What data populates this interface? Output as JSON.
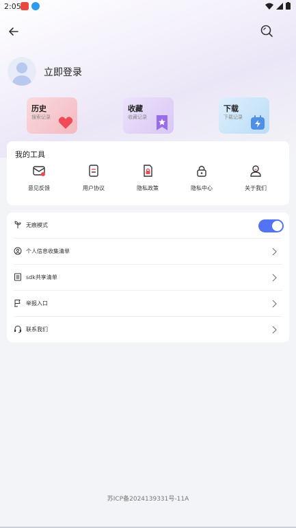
{
  "status_bar": {
    "time": "2:05"
  },
  "header": {
    "back_icon": "back-arrow-icon",
    "search_icon": "search-icon"
  },
  "profile": {
    "login_label": "立即登录"
  },
  "quick_cards": [
    {
      "title": "历史",
      "subtitle": "搜索记录",
      "icon": "heart-icon",
      "color": "#f4b9c0"
    },
    {
      "title": "收藏",
      "subtitle": "收藏记录",
      "icon": "bookmark-star-icon",
      "color": "#d8c7f4"
    },
    {
      "title": "下载",
      "subtitle": "下载记录",
      "icon": "download-calendar-icon",
      "color": "#bcdcf6"
    }
  ],
  "tools": {
    "title": "我的工具",
    "items": [
      {
        "label": "意见反馈",
        "icon": "feedback-mail-icon"
      },
      {
        "label": "用户协议",
        "icon": "document-icon"
      },
      {
        "label": "隐私政策",
        "icon": "privacy-doc-lock-icon"
      },
      {
        "label": "隐私中心",
        "icon": "lock-icon"
      },
      {
        "label": "关于我们",
        "icon": "user-icon"
      }
    ]
  },
  "settings": [
    {
      "label": "无痕模式",
      "icon": "sprout-icon",
      "toggle_on": true
    },
    {
      "label": "个人信息收集清单",
      "icon": "user-circle-icon"
    },
    {
      "label": "sdk共享清单",
      "icon": "list-icon"
    },
    {
      "label": "举报入口",
      "icon": "report-icon"
    },
    {
      "label": "联系我们",
      "icon": "headset-icon"
    }
  ],
  "footer": {
    "icp": "苏ICP备2024139331号-11A"
  },
  "colors": {
    "accent": "#5274f2",
    "background": "#f3f4f7"
  }
}
